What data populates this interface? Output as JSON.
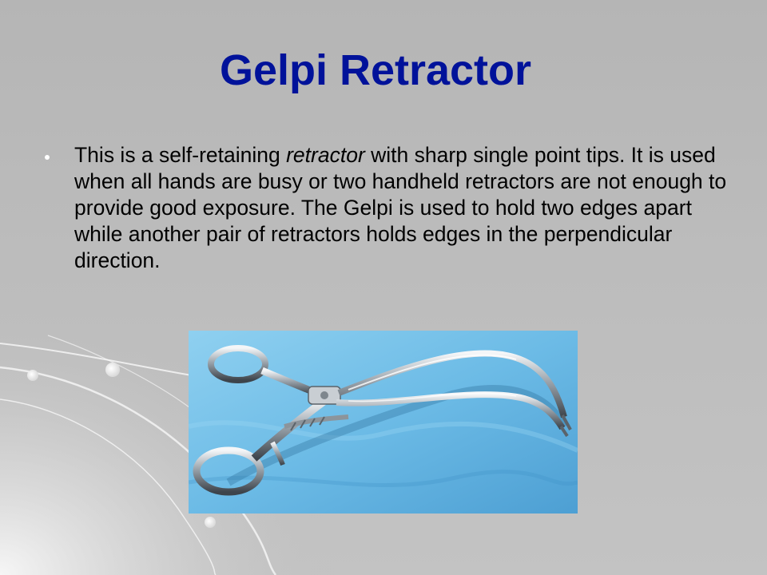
{
  "slide": {
    "title": "Gelpi Retractor",
    "bullets": [
      {
        "text_before": "This is a self-retaining ",
        "text_emphasis": "retractor",
        "text_after": " with sharp single point tips.  It is used when all hands are busy or two handheld retractors are not enough to provide good exposure. The Gelpi is used to hold two edges apart while another pair of retractors holds edges in the perpendicular direction."
      }
    ],
    "image": {
      "subject": "gelpi-retractor-photo"
    }
  },
  "colors": {
    "title": "#00129a",
    "background": "#bcbcbc",
    "photo_background": "#5fb0e0",
    "bullet": "#ffffff"
  }
}
